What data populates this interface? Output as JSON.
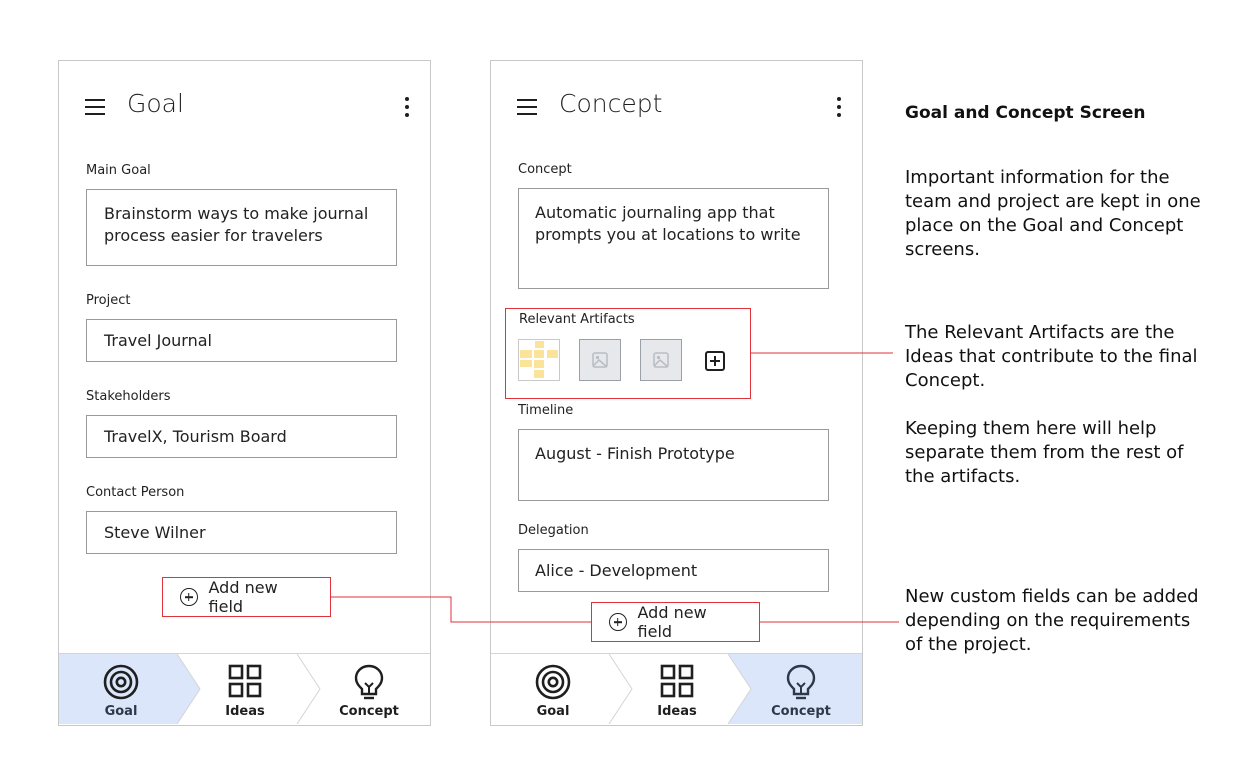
{
  "goal_screen": {
    "title": "Goal",
    "fields": {
      "main_goal": {
        "label": "Main Goal",
        "value": "Brainstorm ways to make journal process easier for travelers"
      },
      "project": {
        "label": "Project",
        "value": "Travel Journal"
      },
      "stakeholders": {
        "label": "Stakeholders",
        "value": "TravelX, Tourism Board"
      },
      "contact_person": {
        "label": "Contact Person",
        "value": "Steve Wilner"
      }
    },
    "add_field_label": "Add new field",
    "tabs": [
      {
        "label": "Goal",
        "icon": "target-icon",
        "active": true
      },
      {
        "label": "Ideas",
        "icon": "grid-icon",
        "active": false
      },
      {
        "label": "Concept",
        "icon": "lightbulb-icon",
        "active": false
      }
    ]
  },
  "concept_screen": {
    "title": "Concept",
    "fields": {
      "concept": {
        "label": "Concept",
        "value": "Automatic journaling app that prompts you at locations to write"
      },
      "relevant_artifacts": {
        "label": "Relevant Artifacts",
        "items": [
          "sticky-notes-thumbnail",
          "image-placeholder",
          "image-placeholder"
        ]
      },
      "timeline": {
        "label": "Timeline",
        "value": "August - Finish Prototype"
      },
      "delegation": {
        "label": "Delegation",
        "value": "Alice - Development"
      }
    },
    "add_field_label": "Add new field",
    "tabs": [
      {
        "label": "Goal",
        "icon": "target-icon",
        "active": false
      },
      {
        "label": "Ideas",
        "icon": "grid-icon",
        "active": false
      },
      {
        "label": "Concept",
        "icon": "lightbulb-icon",
        "active": true
      }
    ]
  },
  "annotations": {
    "heading": "Goal and Concept Screen",
    "intro": "Important information for the team and project are kept in one place on the Goal and Concept screens.",
    "artifacts_note_1": "The Relevant Artifacts are the Ideas that contribute to the final Concept.",
    "artifacts_note_2": "Keeping them here will help separate them from the rest of the artifacts.",
    "custom_fields_note": "New custom fields can be added depending on the requirements of the project."
  },
  "colors": {
    "active_tab_bg": "#dbe6fb",
    "highlight_border": "#e0323a",
    "field_border": "#9a9a9a"
  }
}
